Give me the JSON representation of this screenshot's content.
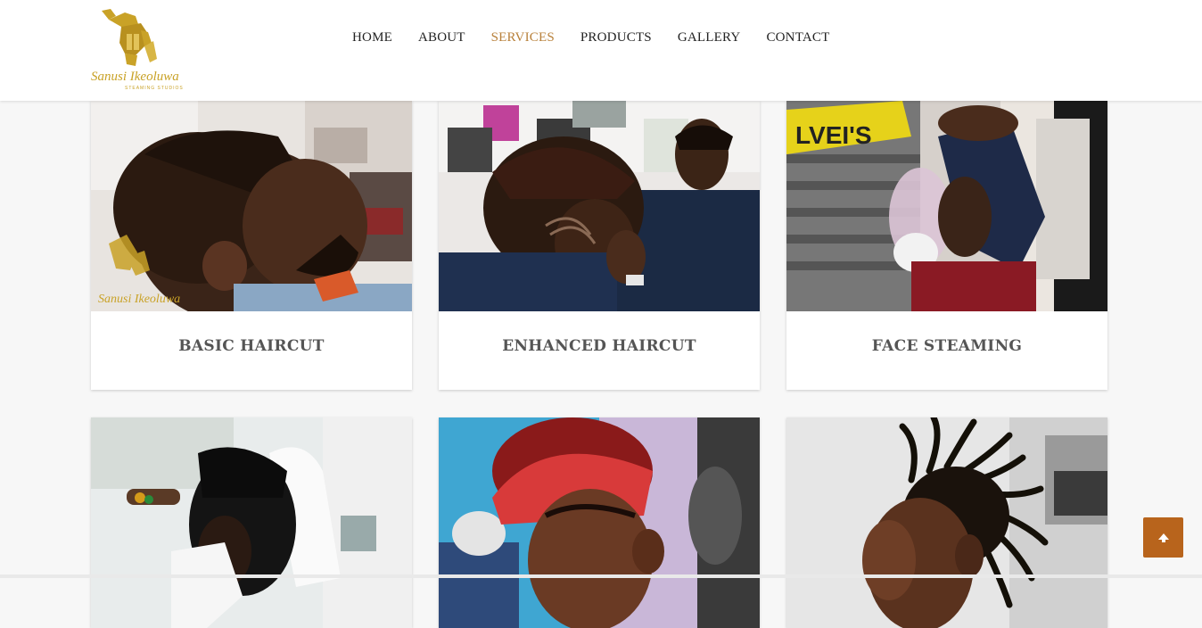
{
  "brand": {
    "logo_text": "Sanusi Ikeoluwa",
    "logo_subtext": "STEAMING STUDIOS"
  },
  "nav": {
    "items": [
      {
        "label": "HOME",
        "active": false
      },
      {
        "label": "ABOUT",
        "active": false
      },
      {
        "label": "SERVICES",
        "active": true
      },
      {
        "label": "PRODUCTS",
        "active": false
      },
      {
        "label": "GALLERY",
        "active": false
      },
      {
        "label": "CONTACT",
        "active": false
      }
    ]
  },
  "services": [
    {
      "title": "BASIC HAIRCUT",
      "watermark": "Sanusi Ikeoluwa"
    },
    {
      "title": "ENHANCED HAIRCUT"
    },
    {
      "title": "FACE STEAMING",
      "shirt_text": "LVEI'S"
    },
    {
      "title": ""
    },
    {
      "title": ""
    },
    {
      "title": ""
    }
  ],
  "colors": {
    "accent": "#b8803a",
    "scroll_button": "#b8641c",
    "title_text": "#555555"
  },
  "scroll_top": {
    "icon": "arrow-up-icon"
  }
}
